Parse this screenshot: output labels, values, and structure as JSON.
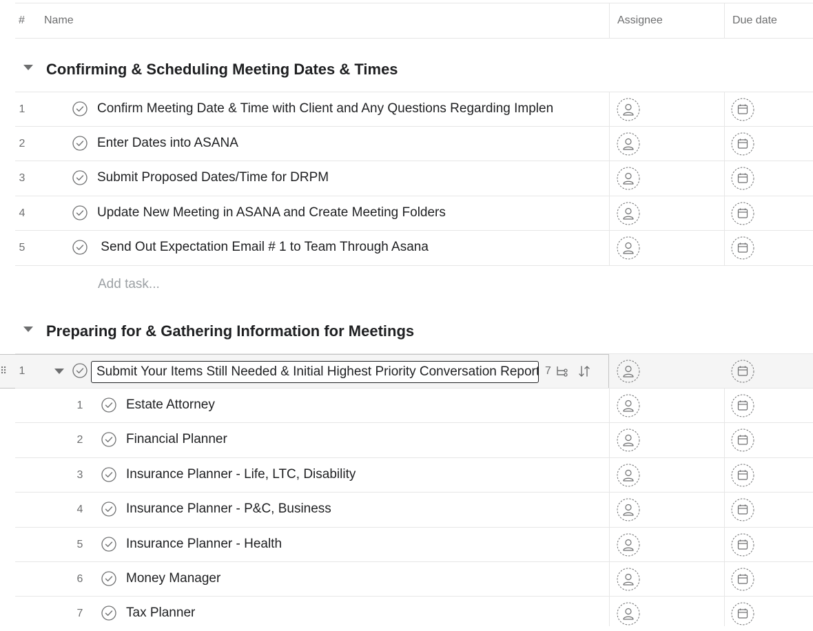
{
  "columns": {
    "num": "#",
    "name": "Name",
    "assignee": "Assignee",
    "due": "Due date"
  },
  "sections": [
    {
      "title": "Confirming & Scheduling Meeting Dates & Times",
      "tasks": [
        {
          "num": "1",
          "name": "Confirm Meeting Date & Time with Client and Any Questions Regarding Implen"
        },
        {
          "num": "2",
          "name": "Enter Dates into ASANA"
        },
        {
          "num": "3",
          "name": "Submit Proposed Dates/Time for DRPM"
        },
        {
          "num": "4",
          "name": "Update New Meeting in ASANA and Create Meeting Folders"
        },
        {
          "num": "5",
          "name": " Send Out Expectation Email # 1 to Team Through Asana"
        }
      ],
      "add_task": "Add task..."
    },
    {
      "title": "Preparing for & Gathering Information for Meetings",
      "tasks": [
        {
          "num": "1",
          "name": "Submit Your Items Still Needed & Initial Highest Priority Conversation Report",
          "subtask_count": "7",
          "subtasks": [
            {
              "num": "1",
              "name": "Estate Attorney"
            },
            {
              "num": "2",
              "name": "Financial Planner"
            },
            {
              "num": "3",
              "name": "Insurance Planner - Life, LTC, Disability"
            },
            {
              "num": "4",
              "name": "Insurance Planner - P&C, Business"
            },
            {
              "num": "5",
              "name": "Insurance Planner - Health"
            },
            {
              "num": "6",
              "name": "Money Manager"
            },
            {
              "num": "7",
              "name": "Tax Planner"
            }
          ]
        }
      ]
    }
  ],
  "icons": {
    "check": "check-circle-icon",
    "assignee": "user-placeholder-icon",
    "due": "calendar-icon",
    "subtasks": "subtask-icon",
    "sort": "sort-icon",
    "drag": "drag-handle-icon",
    "caret": "caret-down-icon"
  },
  "colors": {
    "text": "#1e1f21",
    "muted": "#6d6e6f",
    "border": "#e6e6e6",
    "placeholder": "#9ca0a4"
  }
}
